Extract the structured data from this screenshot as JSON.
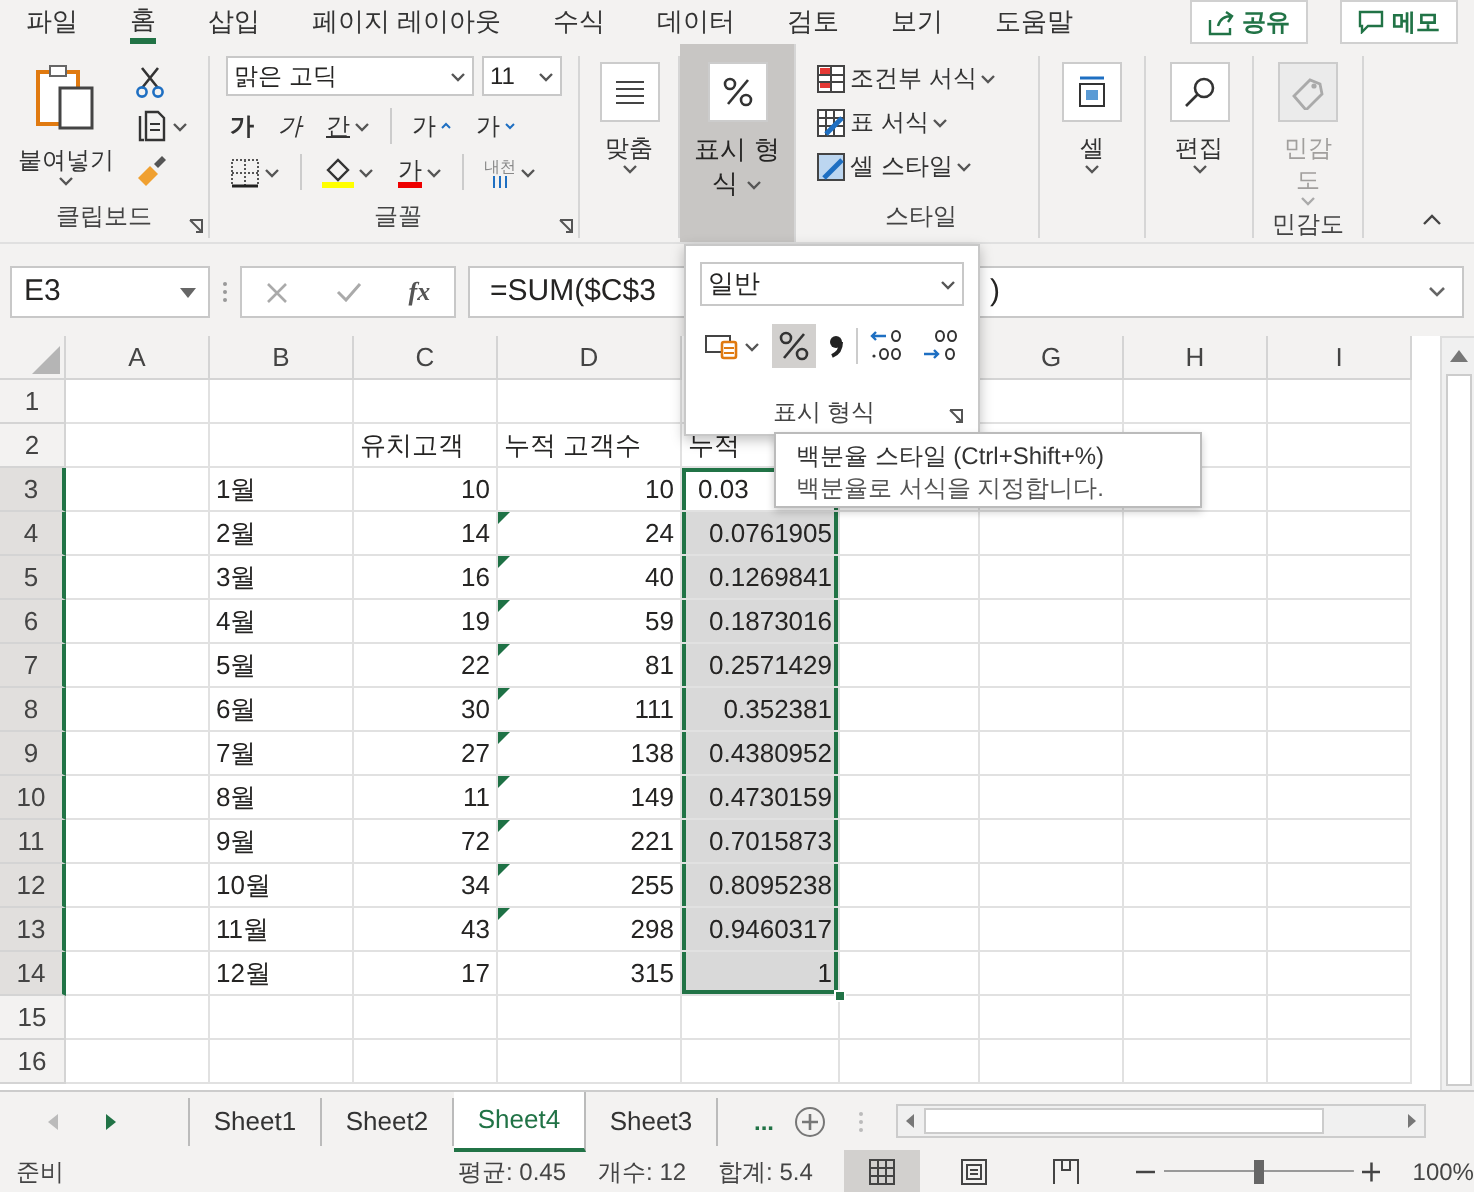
{
  "menu_tabs": [
    {
      "label": "파일",
      "selected": false
    },
    {
      "label": "홈",
      "selected": true
    },
    {
      "label": "삽입",
      "selected": false
    },
    {
      "label": "페이지 레이아웃",
      "selected": false
    },
    {
      "label": "수식",
      "selected": false
    },
    {
      "label": "데이터",
      "selected": false
    },
    {
      "label": "검토",
      "selected": false
    },
    {
      "label": "보기",
      "selected": false
    },
    {
      "label": "도움말",
      "selected": false
    }
  ],
  "share_button": "공유",
  "comment_button": "메모",
  "ribbon": {
    "clipboard": {
      "paste": "붙여넣기",
      "title": "클립보드"
    },
    "font": {
      "name": "맑은 고딕",
      "size": "11",
      "bold": "가",
      "italic": "가",
      "underline": "간",
      "grow": "가",
      "shrink": "가",
      "font_color": "가",
      "phonetic": "내천",
      "title": "글꼴"
    },
    "alignment": {
      "label": "맞춤"
    },
    "number": {
      "label": "표시 형식",
      "pressed": true
    },
    "styles": {
      "items": [
        {
          "label": "조건부 서식",
          "kind": "conditional"
        },
        {
          "label": "표 서식",
          "kind": "table"
        },
        {
          "label": "셀 스타일",
          "kind": "cell"
        }
      ],
      "title": "스타일"
    },
    "cells": {
      "label": "셀"
    },
    "editing": {
      "label": "편집"
    },
    "sensitivity": {
      "label": "민감도",
      "disabled": true,
      "title": "민감도"
    }
  },
  "formula_bar": {
    "name_box": "E3",
    "function_label": "fx",
    "formula": "=SUM($C$3",
    "formula_tail": ")"
  },
  "number_format_popup": {
    "format": "일반",
    "percent_selected": true,
    "title": "표시 형식"
  },
  "tooltip": {
    "title": "백분율 스타일 (Ctrl+Shift+%)",
    "description": "백분율로 서식을 지정합니다."
  },
  "columns": [
    {
      "label": "A"
    },
    {
      "label": "B"
    },
    {
      "label": "C"
    },
    {
      "label": "D"
    },
    {
      "label": "G"
    },
    {
      "label": "H"
    },
    {
      "label": "I"
    }
  ],
  "rows": [
    {
      "number": "1",
      "kind": "blank",
      "selected": false
    },
    {
      "number": "2",
      "kind": "header",
      "selected": false,
      "c": "유치고객",
      "d": "누적 고객수",
      "e": "누적"
    },
    {
      "number": "3",
      "kind": "data",
      "selected": true,
      "active": true,
      "b": "1월",
      "c": "10",
      "d": "10",
      "e": "0.03",
      "flag": false
    },
    {
      "number": "4",
      "kind": "data",
      "selected": true,
      "active": false,
      "b": "2월",
      "c": "14",
      "d": "24",
      "e": "0.0761905",
      "flag": true
    },
    {
      "number": "5",
      "kind": "data",
      "selected": true,
      "active": false,
      "b": "3월",
      "c": "16",
      "d": "40",
      "e": "0.1269841",
      "flag": true
    },
    {
      "number": "6",
      "kind": "data",
      "selected": true,
      "active": false,
      "b": "4월",
      "c": "19",
      "d": "59",
      "e": "0.1873016",
      "flag": true
    },
    {
      "number": "7",
      "kind": "data",
      "selected": true,
      "active": false,
      "b": "5월",
      "c": "22",
      "d": "81",
      "e": "0.2571429",
      "flag": true
    },
    {
      "number": "8",
      "kind": "data",
      "selected": true,
      "active": false,
      "b": "6월",
      "c": "30",
      "d": "111",
      "e": "0.352381",
      "flag": true
    },
    {
      "number": "9",
      "kind": "data",
      "selected": true,
      "active": false,
      "b": "7월",
      "c": "27",
      "d": "138",
      "e": "0.4380952",
      "flag": true
    },
    {
      "number": "10",
      "kind": "data",
      "selected": true,
      "active": false,
      "b": "8월",
      "c": "11",
      "d": "149",
      "e": "0.4730159",
      "flag": true
    },
    {
      "number": "11",
      "kind": "data",
      "selected": true,
      "active": false,
      "b": "9월",
      "c": "72",
      "d": "221",
      "e": "0.7015873",
      "flag": true
    },
    {
      "number": "12",
      "kind": "data",
      "selected": true,
      "active": false,
      "b": "10월",
      "c": "34",
      "d": "255",
      "e": "0.8095238",
      "flag": true
    },
    {
      "number": "13",
      "kind": "data",
      "selected": true,
      "active": false,
      "b": "11월",
      "c": "43",
      "d": "298",
      "e": "0.9460317",
      "flag": true
    },
    {
      "number": "14",
      "kind": "data",
      "selected": true,
      "active": false,
      "b": "12월",
      "c": "17",
      "d": "315",
      "e": "1",
      "flag": false
    },
    {
      "number": "15",
      "kind": "blank",
      "selected": false
    },
    {
      "number": "16",
      "kind": "blank",
      "selected": false
    }
  ],
  "sheet_tabs": [
    {
      "label": "Sheet1",
      "selected": false
    },
    {
      "label": "Sheet2",
      "selected": false
    },
    {
      "label": "Sheet4",
      "selected": true
    },
    {
      "label": "Sheet3",
      "selected": false
    }
  ],
  "more_sheets": "...",
  "status_bar": {
    "ready": "준비",
    "average": "평균: 0.45",
    "count": "개수: 12",
    "sum": "합계: 5.4",
    "views": [
      {
        "kind": "normal",
        "selected": true
      },
      {
        "kind": "page_layout",
        "selected": false
      },
      {
        "kind": "page_break",
        "selected": false
      }
    ],
    "zoom": "100%",
    "zoom_slider": {
      "level": 0.5
    }
  }
}
